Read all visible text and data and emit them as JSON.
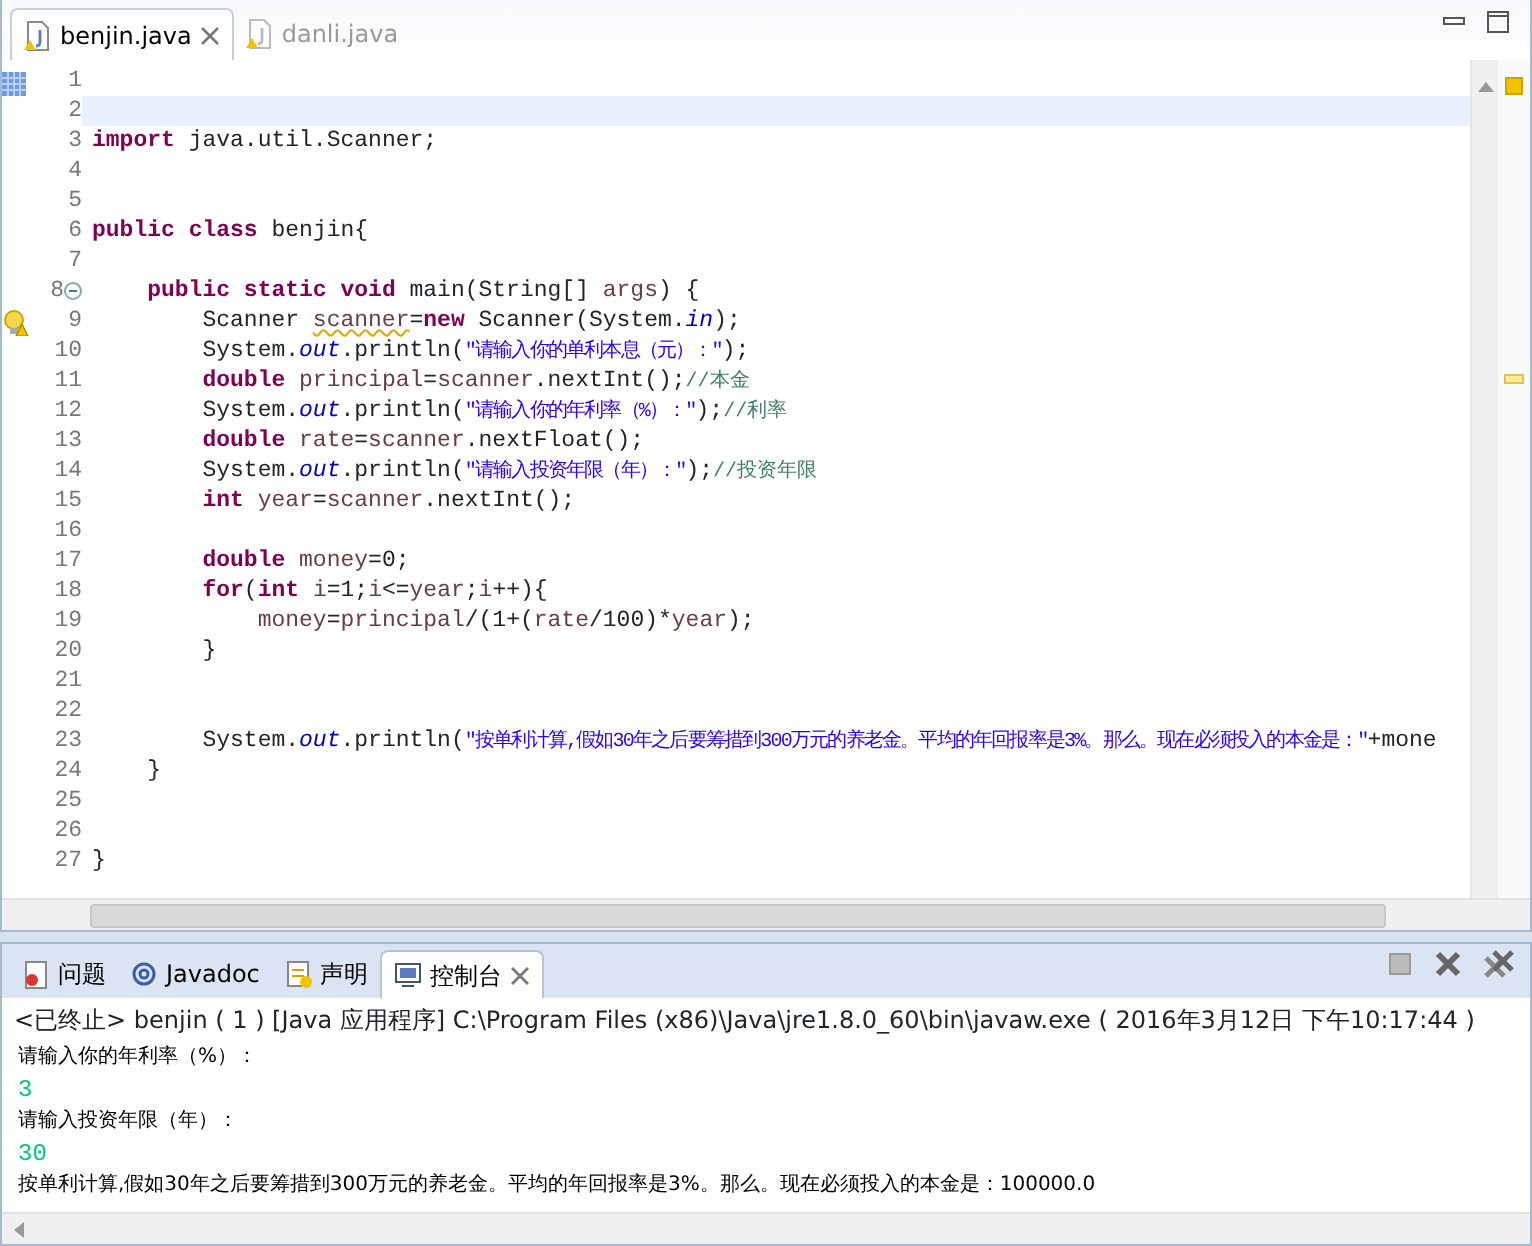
{
  "editor": {
    "tabs": [
      {
        "label": "benjin.java",
        "selected": true,
        "closable": true
      },
      {
        "label": "danli.java",
        "selected": false,
        "closable": false
      }
    ],
    "lines": [
      {
        "number": "1",
        "current": false,
        "kind": "range"
      },
      {
        "number": "2",
        "current": true
      },
      {
        "number": "3",
        "current": false,
        "tokens": [
          {
            "kind": "kw",
            "text": "import"
          },
          {
            "kind": "plain",
            "text": " java.util.Scanner;"
          }
        ]
      },
      {
        "number": "4",
        "current": false
      },
      {
        "number": "5",
        "current": false
      },
      {
        "number": "6",
        "current": false,
        "tokens": [
          {
            "kind": "kw",
            "text": "public "
          },
          {
            "kind": "kw",
            "text": "class "
          },
          {
            "kind": "plain",
            "text": "benjin{"
          }
        ]
      },
      {
        "number": "7",
        "current": false
      },
      {
        "number": "8",
        "current": false,
        "kind": "fold",
        "tokens": [
          {
            "kind": "kw",
            "text": "    public "
          },
          {
            "kind": "kw",
            "text": "static "
          },
          {
            "kind": "kw",
            "text": "void "
          },
          {
            "kind": "plain",
            "text": "main(String[] "
          },
          {
            "kind": "local",
            "text": "args"
          },
          {
            "kind": "plain",
            "text": ") {"
          }
        ]
      },
      {
        "number": "9",
        "current": false,
        "kind": "warning",
        "tokens": [
          {
            "kind": "plain",
            "text": "        Scanner "
          },
          {
            "kind": "local-warn",
            "text": "scanner"
          },
          {
            "kind": "plain",
            "text": "="
          },
          {
            "kind": "kw",
            "text": "new"
          },
          {
            "kind": "plain",
            "text": " Scanner(System."
          },
          {
            "kind": "field",
            "text": "in"
          },
          {
            "kind": "plain",
            "text": ");"
          }
        ]
      },
      {
        "number": "10",
        "current": false,
        "tokens": [
          {
            "kind": "plain",
            "text": "        System."
          },
          {
            "kind": "field",
            "text": "out"
          },
          {
            "kind": "plain",
            "text": ".println("
          },
          {
            "kind": "str",
            "text": "\"请输入你的单利本息（元）：\""
          },
          {
            "kind": "plain",
            "text": ");"
          }
        ]
      },
      {
        "number": "11",
        "current": false,
        "tokens": [
          {
            "kind": "kw",
            "text": "        double "
          },
          {
            "kind": "local",
            "text": "principal"
          },
          {
            "kind": "plain",
            "text": "="
          },
          {
            "kind": "local",
            "text": "scanner"
          },
          {
            "kind": "plain",
            "text": ".nextInt();"
          },
          {
            "kind": "comment",
            "text": "//本金"
          }
        ]
      },
      {
        "number": "12",
        "current": false,
        "tokens": [
          {
            "kind": "plain",
            "text": "        System."
          },
          {
            "kind": "field",
            "text": "out"
          },
          {
            "kind": "plain",
            "text": ".println("
          },
          {
            "kind": "str",
            "text": "\"请输入你的年利率（%）：\""
          },
          {
            "kind": "plain",
            "text": ");"
          },
          {
            "kind": "comment",
            "text": "//利率"
          }
        ]
      },
      {
        "number": "13",
        "current": false,
        "tokens": [
          {
            "kind": "kw",
            "text": "        double "
          },
          {
            "kind": "local",
            "text": "rate"
          },
          {
            "kind": "plain",
            "text": "="
          },
          {
            "kind": "local",
            "text": "scanner"
          },
          {
            "kind": "plain",
            "text": ".nextFloat();"
          }
        ]
      },
      {
        "number": "14",
        "current": false,
        "tokens": [
          {
            "kind": "plain",
            "text": "        System."
          },
          {
            "kind": "field",
            "text": "out"
          },
          {
            "kind": "plain",
            "text": ".println("
          },
          {
            "kind": "str",
            "text": "\"请输入投资年限（年）：\""
          },
          {
            "kind": "plain",
            "text": ");"
          },
          {
            "kind": "comment",
            "text": "//投资年限"
          }
        ]
      },
      {
        "number": "15",
        "current": false,
        "tokens": [
          {
            "kind": "kw",
            "text": "        int "
          },
          {
            "kind": "local",
            "text": "year"
          },
          {
            "kind": "plain",
            "text": "="
          },
          {
            "kind": "local",
            "text": "scanner"
          },
          {
            "kind": "plain",
            "text": ".nextInt();"
          }
        ]
      },
      {
        "number": "16",
        "current": false
      },
      {
        "number": "17",
        "current": false,
        "tokens": [
          {
            "kind": "kw",
            "text": "        double "
          },
          {
            "kind": "local",
            "text": "money"
          },
          {
            "kind": "plain",
            "text": "=0;"
          }
        ]
      },
      {
        "number": "18",
        "current": false,
        "tokens": [
          {
            "kind": "kw",
            "text": "        for"
          },
          {
            "kind": "plain",
            "text": "("
          },
          {
            "kind": "kw",
            "text": "int "
          },
          {
            "kind": "local",
            "text": "i"
          },
          {
            "kind": "plain",
            "text": "=1;"
          },
          {
            "kind": "local",
            "text": "i"
          },
          {
            "kind": "plain",
            "text": "<="
          },
          {
            "kind": "local",
            "text": "year"
          },
          {
            "kind": "plain",
            "text": ";"
          },
          {
            "kind": "local",
            "text": "i"
          },
          {
            "kind": "plain",
            "text": "++){"
          }
        ]
      },
      {
        "number": "19",
        "current": false,
        "tokens": [
          {
            "kind": "local",
            "text": "            money"
          },
          {
            "kind": "plain",
            "text": "="
          },
          {
            "kind": "local",
            "text": "principal"
          },
          {
            "kind": "plain",
            "text": "/(1+("
          },
          {
            "kind": "local",
            "text": "rate"
          },
          {
            "kind": "plain",
            "text": "/100)*"
          },
          {
            "kind": "local",
            "text": "year"
          },
          {
            "kind": "plain",
            "text": ");"
          }
        ]
      },
      {
        "number": "20",
        "current": false,
        "tokens": [
          {
            "kind": "plain",
            "text": "        }"
          }
        ]
      },
      {
        "number": "21",
        "current": false
      },
      {
        "number": "22",
        "current": false
      },
      {
        "number": "23",
        "current": false,
        "tokens": [
          {
            "kind": "plain",
            "text": "        System."
          },
          {
            "kind": "field",
            "text": "out"
          },
          {
            "kind": "plain",
            "text": ".println("
          },
          {
            "kind": "str",
            "text": "\"按单利计算,假如30年之后要筹措到300万元的养老金。平均的年回报率是3%。那么。现在必须投入的本金是：\""
          },
          {
            "kind": "plain",
            "text": "+mone"
          }
        ]
      },
      {
        "number": "24",
        "current": false,
        "tokens": [
          {
            "kind": "plain",
            "text": "    }"
          }
        ]
      },
      {
        "number": "25",
        "current": false
      },
      {
        "number": "26",
        "current": false
      },
      {
        "number": "27",
        "current": false,
        "tokens": [
          {
            "kind": "plain",
            "text": "}"
          }
        ]
      }
    ]
  },
  "panel": {
    "tabs": [
      {
        "label": "问题",
        "kind": "problems",
        "selected": false,
        "closable": false
      },
      {
        "label": "Javadoc",
        "kind": "javadoc",
        "selected": false,
        "closable": false
      },
      {
        "label": "声明",
        "kind": "declaration",
        "selected": false,
        "closable": false
      },
      {
        "label": "控制台",
        "kind": "console",
        "selected": true,
        "closable": true
      }
    ],
    "console_title": "<已终止> benjin ( 1 ) [Java 应用程序] C:\\Program Files (x86)\\Java\\jre1.8.0_60\\bin\\javaw.exe ( 2016年3月12日 下午10:17:44 )",
    "console_lines": [
      {
        "kind": "output",
        "text": "请输入你的年利率（%）："
      },
      {
        "kind": "input",
        "text": "3"
      },
      {
        "kind": "output",
        "text": "请输入投资年限（年）："
      },
      {
        "kind": "input",
        "text": "30"
      },
      {
        "kind": "output",
        "text": "按单利计算,假如30年之后要筹措到300万元的养老金。平均的年回报率是3%。那么。现在必须投入的本金是：100000.0"
      }
    ]
  }
}
